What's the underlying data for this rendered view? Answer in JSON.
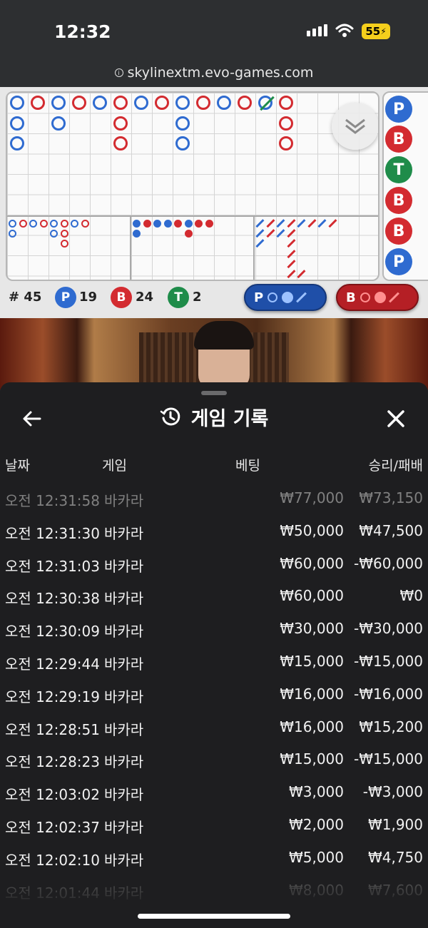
{
  "status_bar": {
    "time": "12:32",
    "battery": "55"
  },
  "browser": {
    "url": "skylinextm.evo-games.com"
  },
  "scoreboard": {
    "round_count": "# 45",
    "player": {
      "letter": "P",
      "count": "19"
    },
    "banker": {
      "letter": "B",
      "count": "24"
    },
    "tie": {
      "letter": "T",
      "count": "2"
    },
    "player_predict": "P",
    "banker_predict": "B",
    "bead_road": [
      "P",
      "B",
      "T",
      "B",
      "B",
      "P"
    ],
    "colors": {
      "player": "#2f6bd0",
      "banker": "#d32b30",
      "tie": "#1f8c4a"
    }
  },
  "history": {
    "title": "게임 기록",
    "columns": {
      "date": "날짜",
      "game": "게임",
      "bet": "베팅",
      "result": "승리/패배"
    },
    "rows": [
      {
        "date": "오전 12:31:58",
        "game": "바카라",
        "bet": "₩77,000",
        "result": "₩73,150"
      },
      {
        "date": "오전 12:31:30",
        "game": "바카라",
        "bet": "₩50,000",
        "result": "₩47,500"
      },
      {
        "date": "오전 12:31:03",
        "game": "바카라",
        "bet": "₩60,000",
        "result": "-₩60,000"
      },
      {
        "date": "오전 12:30:38",
        "game": "바카라",
        "bet": "₩60,000",
        "result": "₩0"
      },
      {
        "date": "오전 12:30:09",
        "game": "바카라",
        "bet": "₩30,000",
        "result": "-₩30,000"
      },
      {
        "date": "오전 12:29:44",
        "game": "바카라",
        "bet": "₩15,000",
        "result": "-₩15,000"
      },
      {
        "date": "오전 12:29:19",
        "game": "바카라",
        "bet": "₩16,000",
        "result": "-₩16,000"
      },
      {
        "date": "오전 12:28:51",
        "game": "바카라",
        "bet": "₩16,000",
        "result": "₩15,200"
      },
      {
        "date": "오전 12:28:23",
        "game": "바카라",
        "bet": "₩15,000",
        "result": "-₩15,000"
      },
      {
        "date": "오전 12:03:02",
        "game": "바카라",
        "bet": "₩3,000",
        "result": "-₩3,000"
      },
      {
        "date": "오전 12:02:37",
        "game": "바카라",
        "bet": "₩2,000",
        "result": "₩1,900"
      },
      {
        "date": "오전 12:02:10",
        "game": "바카라",
        "bet": "₩5,000",
        "result": "₩4,750"
      },
      {
        "date": "오전 12:01:44",
        "game": "바카라",
        "bet": "₩8,000",
        "result": "₩7,600"
      }
    ]
  }
}
